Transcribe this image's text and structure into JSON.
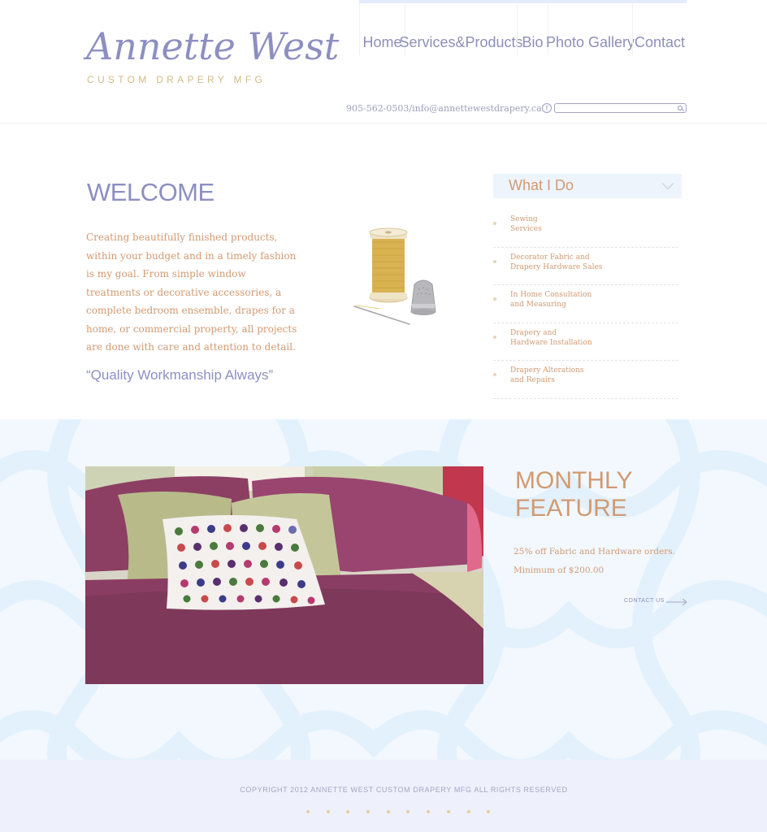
{
  "logo": {
    "name": "Annette West",
    "subtitle": "CUSTOM DRAPERY MFG"
  },
  "nav": {
    "items": [
      {
        "label": "Home"
      },
      {
        "label": "Services&Products"
      },
      {
        "label": "Bio"
      },
      {
        "label": "Photo Gallery"
      },
      {
        "label": "Contact"
      }
    ]
  },
  "contact": {
    "line": "905-562-0503/info@annettewestdrapery.ca",
    "facebook_icon": "f"
  },
  "search": {
    "value": "",
    "placeholder": ""
  },
  "welcome": {
    "title": "WELCOME",
    "body": "Creating beautifully finished products, within your budget and in a timely fashion is my goal. From simple window treatments or decorative accessories,  a complete bedroom ensemble, drapes for a home, or commercial property, all projects are done with care and attention to detail.",
    "quote": "“Quality Workmanship Always”"
  },
  "what_i_do": {
    "title": "What I Do",
    "items": [
      {
        "line1": "Sewing",
        "line2": "Services"
      },
      {
        "line1": "Decorator Fabric and",
        "line2": "Drapery Hardware Sales"
      },
      {
        "line1": "In Home Consultation",
        "line2": "and Measuring"
      },
      {
        "line1": "Drapery and",
        "line2": "Hardware Installation"
      },
      {
        "line1": "Drapery Alterations",
        "line2": "and Repairs"
      }
    ]
  },
  "feature": {
    "title_line1": "MONTHLY",
    "title_line2": "FEATURE",
    "text1": "25% off Fabric and Hardware orders.",
    "text2": "Minimum of $200.00",
    "link": "CONTACT US"
  },
  "footer": {
    "copyright": "COPYRIGHT 2012 ANNETTE WEST CUSTOM DRAPERY MFG ALL RIGHTS RESERVED",
    "dot_count": 10
  },
  "colors": {
    "brand_lavender": "#8d8fc2",
    "accent_tan": "#d19a72",
    "gold": "#d2bb85",
    "band_bg": "#f2f8fe",
    "footer_bg": "#eef0fb"
  }
}
